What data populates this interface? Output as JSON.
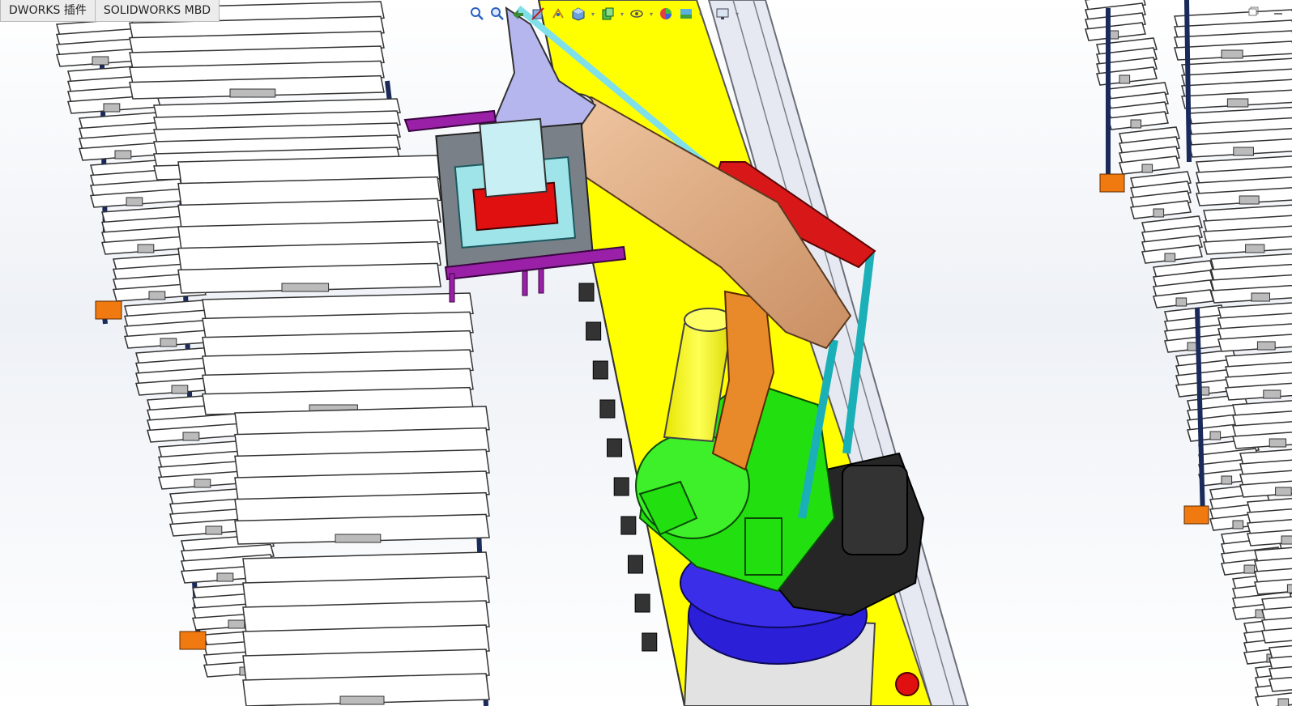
{
  "tabs": [
    {
      "label": "DWORKS 插件",
      "active": false
    },
    {
      "label": "SOLIDWORKS MBD",
      "active": false
    }
  ],
  "hud_icons": [
    "zoom-to-fit-icon",
    "zoom-to-area-icon",
    "previous-view-icon",
    "section-view-icon",
    "dynamic-annotation-icon",
    "view-orientation-icon",
    "display-style-icon",
    "hide-show-items-icon",
    "edit-appearance-icon",
    "apply-scene-icon",
    "view-settings-icon"
  ],
  "window_icons": [
    "restore-window-icon",
    "minimize-window-icon"
  ],
  "colors": {
    "conveyor": "#ffff00",
    "robot_base": "#2b1fd8",
    "robot_motor": "#22e010",
    "upper_arm": "#e0b08a",
    "counterweight_link": "#d81818",
    "parallel_link": "#1bb0b8",
    "gripper_frame": "#9a20a8",
    "pallet": "#ffffff",
    "post": "#1a2a5a",
    "foot": "#f07a10"
  }
}
